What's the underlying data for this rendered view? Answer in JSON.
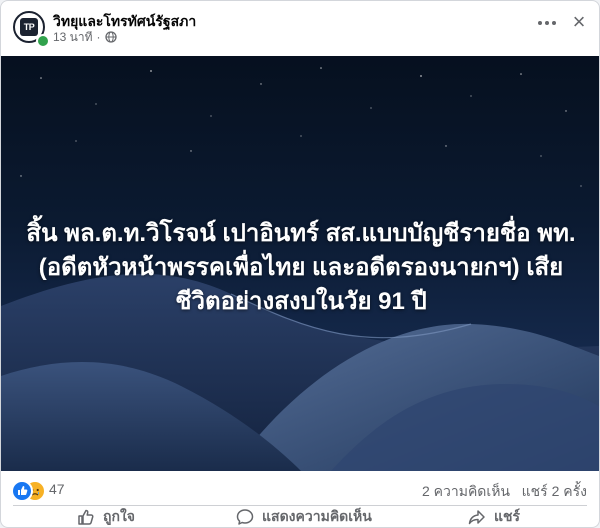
{
  "post": {
    "page_name": "วิทยุและโทรทัศน์รัฐสภา",
    "avatar_text": "TP",
    "timestamp": "13 นาที",
    "separator": "·",
    "privacy_icon": "globe-icon",
    "menu_icon": "more-horizontal-icon",
    "close_icon": "close-icon",
    "headline": "สิ้น พล.ต.ท.วิโรจน์ เปาอินทร์ สส.แบบบัญชีรายชื่อ พท. (อดีตหัวหน้าพรรคเพื่อไทย และอดีตรองนายกฯ) เสียชีวิตอย่างสงบในวัย 91 ปี"
  },
  "stats": {
    "reaction_icons": [
      "like-reaction-icon",
      "sad-reaction-icon"
    ],
    "reaction_count": "47",
    "comments": "2 ความคิดเห็น",
    "shares": "แชร์ 2 ครั้ง"
  },
  "actions": {
    "like": "ถูกใจ",
    "comment": "แสดงความคิดเห็น",
    "share": "แชร์"
  },
  "colors": {
    "like_blue": "#1877f2",
    "sad_yellow": "#f7b125",
    "text_secondary": "#65676b",
    "online_green": "#31a24c",
    "image_background": "#0b1a31"
  }
}
